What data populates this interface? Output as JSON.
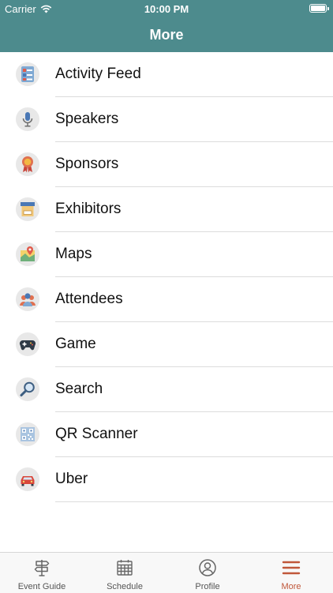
{
  "status_bar": {
    "carrier": "Carrier",
    "time": "10:00 PM"
  },
  "nav": {
    "title": "More"
  },
  "menu": {
    "items": [
      {
        "label": "Activity Feed",
        "icon": "activity-feed-icon"
      },
      {
        "label": "Speakers",
        "icon": "microphone-icon"
      },
      {
        "label": "Sponsors",
        "icon": "award-ribbon-icon"
      },
      {
        "label": "Exhibitors",
        "icon": "booth-icon"
      },
      {
        "label": "Maps",
        "icon": "map-pin-icon"
      },
      {
        "label": "Attendees",
        "icon": "people-icon"
      },
      {
        "label": "Game",
        "icon": "gamepad-icon"
      },
      {
        "label": "Search",
        "icon": "magnifier-icon"
      },
      {
        "label": "QR Scanner",
        "icon": "qr-code-icon"
      },
      {
        "label": "Uber",
        "icon": "car-icon"
      }
    ]
  },
  "tabs": [
    {
      "label": "Event Guide",
      "icon": "signpost-icon",
      "active": false
    },
    {
      "label": "Schedule",
      "icon": "calendar-icon",
      "active": false
    },
    {
      "label": "Profile",
      "icon": "profile-icon",
      "active": false
    },
    {
      "label": "More",
      "icon": "hamburger-icon",
      "active": true
    }
  ],
  "colors": {
    "header": "#4d8b8d",
    "tab_active": "#c0573a",
    "tab_inactive": "#555555"
  }
}
